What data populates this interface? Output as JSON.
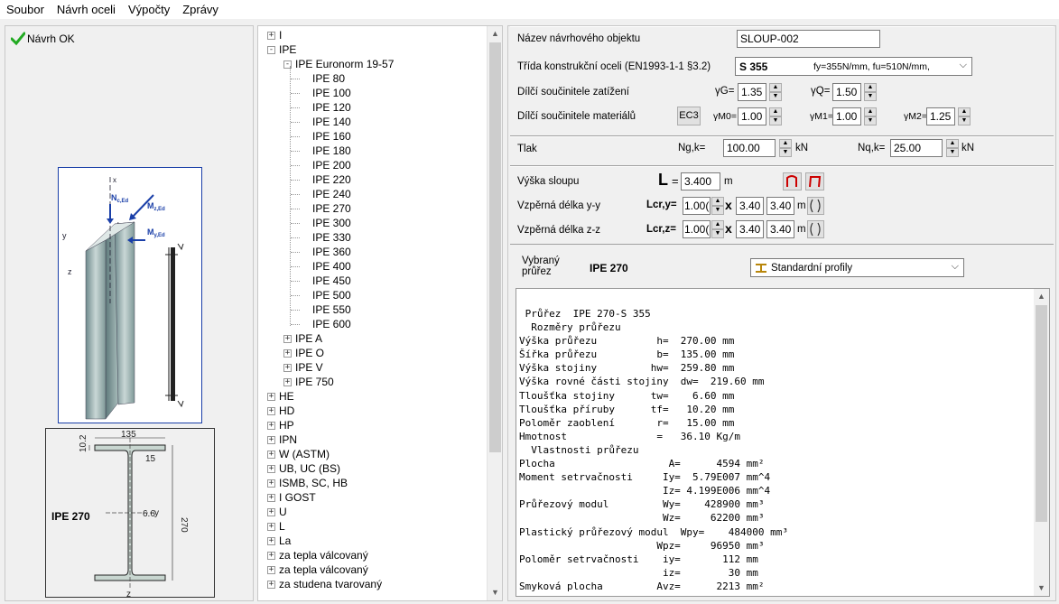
{
  "menu": [
    "Soubor",
    "Návrh oceli",
    "Výpočty",
    "Zprávy"
  ],
  "status": {
    "text": "Návrh OK",
    "color": "#22aa22"
  },
  "figure": {
    "profile_label": "IPE 270",
    "dim_width": "135",
    "dim_height": "270",
    "dim_flange": "10.2",
    "dim_web": "6.6",
    "dim_radius": "15",
    "axis_y": "y",
    "axis_z": "z",
    "axis_x": "x",
    "force_n": "N",
    "force_n_sub": "c,Ed",
    "force_mz": "M",
    "force_mz_sub": "z,Ed",
    "force_my": "M",
    "force_my_sub": "y,Ed",
    "section_axis_y": "y",
    "section_axis_z": "z"
  },
  "tree": {
    "items": [
      {
        "label": "I",
        "level": 0,
        "expander": "+"
      },
      {
        "label": "IPE",
        "level": 0,
        "expander": "-"
      },
      {
        "label": "IPE  Euronorm 19-57",
        "level": 1,
        "expander": "-"
      },
      {
        "label": "IPE 80",
        "level": 2,
        "expander": ""
      },
      {
        "label": "IPE 100",
        "level": 2,
        "expander": ""
      },
      {
        "label": "IPE 120",
        "level": 2,
        "expander": ""
      },
      {
        "label": "IPE 140",
        "level": 2,
        "expander": ""
      },
      {
        "label": "IPE 160",
        "level": 2,
        "expander": ""
      },
      {
        "label": "IPE 180",
        "level": 2,
        "expander": ""
      },
      {
        "label": "IPE 200",
        "level": 2,
        "expander": ""
      },
      {
        "label": "IPE 220",
        "level": 2,
        "expander": ""
      },
      {
        "label": "IPE 240",
        "level": 2,
        "expander": ""
      },
      {
        "label": "IPE 270",
        "level": 2,
        "expander": ""
      },
      {
        "label": "IPE 300",
        "level": 2,
        "expander": ""
      },
      {
        "label": "IPE 330",
        "level": 2,
        "expander": ""
      },
      {
        "label": "IPE 360",
        "level": 2,
        "expander": ""
      },
      {
        "label": "IPE 400",
        "level": 2,
        "expander": ""
      },
      {
        "label": "IPE 450",
        "level": 2,
        "expander": ""
      },
      {
        "label": "IPE 500",
        "level": 2,
        "expander": ""
      },
      {
        "label": "IPE 550",
        "level": 2,
        "expander": ""
      },
      {
        "label": "IPE 600",
        "level": 2,
        "expander": ""
      },
      {
        "label": "IPE A",
        "level": 1,
        "expander": "+"
      },
      {
        "label": "IPE O",
        "level": 1,
        "expander": "+"
      },
      {
        "label": "IPE V",
        "level": 1,
        "expander": "+"
      },
      {
        "label": "IPE 750",
        "level": 1,
        "expander": "+"
      },
      {
        "label": "HE",
        "level": 0,
        "expander": "+"
      },
      {
        "label": "HD",
        "level": 0,
        "expander": "+"
      },
      {
        "label": "HP",
        "level": 0,
        "expander": "+"
      },
      {
        "label": "IPN",
        "level": 0,
        "expander": "+"
      },
      {
        "label": "W (ASTM)",
        "level": 0,
        "expander": "+"
      },
      {
        "label": "UB, UC (BS)",
        "level": 0,
        "expander": "+"
      },
      {
        "label": "ISMB, SC, HB",
        "level": 0,
        "expander": "+"
      },
      {
        "label": "I GOST",
        "level": 0,
        "expander": "+"
      },
      {
        "label": "U",
        "level": 0,
        "expander": "+"
      },
      {
        "label": "L",
        "level": 0,
        "expander": "+"
      },
      {
        "label": "La",
        "level": 0,
        "expander": "+"
      },
      {
        "label": "za tepla válcovaný",
        "level": 0,
        "expander": "+"
      },
      {
        "label": "za tepla válcovaný",
        "level": 0,
        "expander": "+"
      },
      {
        "label": "za studena tvarovaný",
        "level": 0,
        "expander": "+"
      }
    ]
  },
  "form": {
    "name_label": "Název návrhového objektu",
    "name_value": "SLOUP-002",
    "class_label": "Třída konstrukční oceli (EN1993-1-1 §3.2)",
    "class_value": "S 355",
    "class_props": "fy=355N/mm, fu=510N/mm,",
    "load_factors_label": "Dílčí součinitele zatížení",
    "gamma_g_label": "γG=",
    "gamma_g_value": "1.35",
    "gamma_q_label": "γQ=",
    "gamma_q_value": "1.50",
    "material_factors_label": "Dílčí součinitele materiálů",
    "ec3_button": "EC3",
    "gamma_m0_label": "γM0=",
    "gamma_m0_value": "1.00",
    "gamma_m1_label": "γM1=",
    "gamma_m1_value": "1.00",
    "gamma_m2_label": "γM2=",
    "gamma_m2_value": "1.25",
    "compression_label": "Tlak",
    "ngk_label": "Ng,k=",
    "ngk_value": "100.00",
    "ngk_unit": "kN",
    "nqk_label": "Nq,k=",
    "nqk_value": "25.00",
    "nqk_unit": "kN",
    "height_label": "Výška sloupu",
    "height_symbol": "L",
    "height_eq": "=",
    "height_value": "3.400",
    "height_unit": "m",
    "buck_y_label": "Vzpěrná délka y-y",
    "lcry_label": "Lcr,y=",
    "lcry_factor": "1.00(",
    "lcry_l": "3.40",
    "lcry_value": "3.40",
    "lcry_unit": "m",
    "buck_z_label": "Vzpěrná délka z-z",
    "lcrz_label": "Lcr,z=",
    "lcrz_factor": "1.00(",
    "lcrz_l": "3.40",
    "lcrz_value": "3.40",
    "lcrz_unit": "m",
    "times": "x",
    "selected_label": "Vybraný\nprůřez",
    "selected_value": "IPE 270",
    "profiles_dropdown": "Standardní profily"
  },
  "report": {
    "text": " Průřez  IPE 270-S 355\n  Rozměry průřezu\nVýška průřezu          h=  270.00 mm\nŠířka průřezu          b=  135.00 mm\nVýška stojiny         hw=  259.80 mm\nVýška rovné části stojiny  dw=  219.60 mm\nTloušťka stojiny      tw=    6.60 mm\nTloušťka příruby      tf=   10.20 mm\nPoloměr zaoblení       r=   15.00 mm\nHmotnost               =   36.10 Kg/m\n  Vlastnosti průřezu\nPlocha                   A=      4594 mm²\nMoment setrvačnosti     Iy=  5.79E007 mm^4\n                        Iz= 4.199E006 mm^4\nPrůřezový modul         Wy=    428900 mm³\n                        Wz=     62200 mm³\nPlastický průřezový modul  Wpy=    484000 mm³\n                       Wpz=     96950 mm³\nPoloměr setrvačnosti    iy=       112 mm\n                        iz=        30 mm\nSmyková plocha         Avz=      2213 mm²"
  }
}
